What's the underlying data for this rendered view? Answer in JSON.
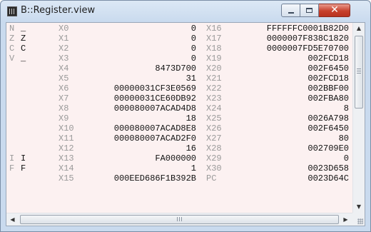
{
  "window": {
    "title": "B::Register.view",
    "controls": {
      "minimize_icon": "minimize-icon",
      "maximize_icon": "maximize-icon",
      "close_glyph": "✕"
    }
  },
  "registers": {
    "rows": [
      {
        "flag": "N",
        "flag_value": "_",
        "reg1": "X0",
        "val1": "0",
        "reg2": "X16",
        "val2": "FFFFFFC0001B82D0"
      },
      {
        "flag": "Z",
        "flag_value": "Z",
        "reg1": "X1",
        "val1": "0",
        "reg2": "X17",
        "val2": "0000007F838C1820"
      },
      {
        "flag": "C",
        "flag_value": "C",
        "reg1": "X2",
        "val1": "0",
        "reg2": "X18",
        "val2": "0000007FD5E70700"
      },
      {
        "flag": "V",
        "flag_value": "_",
        "reg1": "X3",
        "val1": "0",
        "reg2": "X19",
        "val2": "002FCD18"
      },
      {
        "flag": "",
        "flag_value": "",
        "reg1": "X4",
        "val1": "8473D700",
        "reg2": "X20",
        "val2": "002F6450"
      },
      {
        "flag": "",
        "flag_value": "",
        "reg1": "X5",
        "val1": "31",
        "reg2": "X21",
        "val2": "002FCD18"
      },
      {
        "flag": "",
        "flag_value": "",
        "reg1": "X6",
        "val1": "00000031CF3E0569",
        "reg2": "X22",
        "val2": "002BBF00"
      },
      {
        "flag": "",
        "flag_value": "",
        "reg1": "X7",
        "val1": "00000031CE60DB92",
        "reg2": "X23",
        "val2": "002FBA80"
      },
      {
        "flag": "",
        "flag_value": "",
        "reg1": "X8",
        "val1": "000080007ACAD4D8",
        "reg2": "X24",
        "val2": "8"
      },
      {
        "flag": "",
        "flag_value": "",
        "reg1": "X9",
        "val1": "18",
        "reg2": "X25",
        "val2": "0026A798"
      },
      {
        "flag": "",
        "flag_value": "",
        "reg1": "X10",
        "val1": "000080007ACAD8E8",
        "reg2": "X26",
        "val2": "002F6450"
      },
      {
        "flag": "",
        "flag_value": "",
        "reg1": "X11",
        "val1": "000080007ACAD2F0",
        "reg2": "X27",
        "val2": "80"
      },
      {
        "flag": "",
        "flag_value": "",
        "reg1": "X12",
        "val1": "16",
        "reg2": "X28",
        "val2": "002709E0"
      },
      {
        "flag": "I",
        "flag_value": "I",
        "reg1": "X13",
        "val1": "FA000000",
        "reg2": "X29",
        "val2": "0"
      },
      {
        "flag": "F",
        "flag_value": "F",
        "reg1": "X14",
        "val1": "1",
        "reg2": "X30",
        "val2": "0023D658"
      },
      {
        "flag": "",
        "flag_value": "",
        "reg1": "X15",
        "val1": "000EED686F1B392B",
        "reg2": "PC",
        "val2": "0023D64C"
      }
    ]
  },
  "scrollbars": {
    "up_glyph": "▲",
    "down_glyph": "▼",
    "left_glyph": "◀",
    "right_glyph": "▶"
  }
}
